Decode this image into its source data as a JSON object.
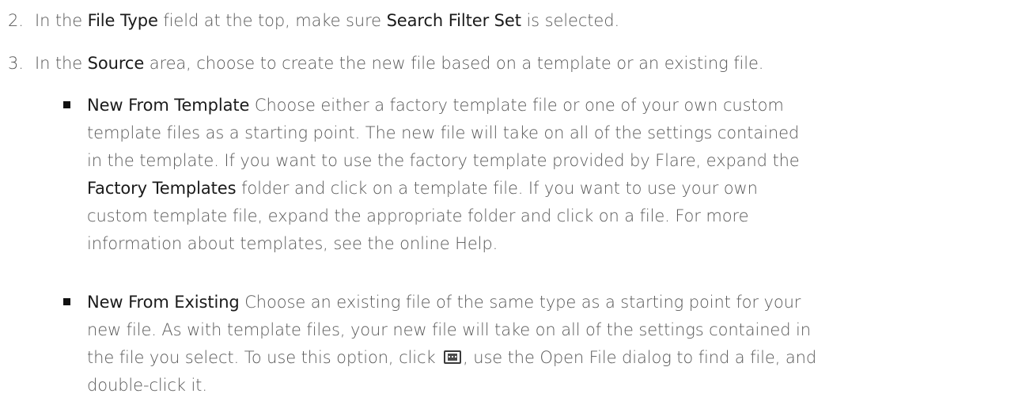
{
  "steps": [
    {
      "number": "2.",
      "parts": [
        "In the ",
        "File Type",
        " field at the top, make sure ",
        "Search Filter Set",
        " is selected."
      ]
    },
    {
      "number": "3.",
      "parts": [
        "In the ",
        "Source",
        " area, choose to create the new file based on a template or an existing file."
      ]
    }
  ],
  "bullets": [
    {
      "term": "New From Template",
      "lines": [
        " Choose either a factory template file or one of your own custom",
        "template files as a starting point. The new file will take on all of the settings contained",
        "in the template. If you want to use the factory template provided by Flare, expand the"
      ],
      "inline_term": "Factory Templates",
      "after_inline": " folder and click on a template file. If you want to use your own",
      "tail_lines": [
        "custom template file, expand the appropriate folder and click on a file. For more",
        "information about templates, see the online Help."
      ]
    },
    {
      "term": "New From Existing",
      "lines": [
        " Choose an existing file of the same type as a starting point for your",
        "new file. As with template files, your new file will take on all of the settings contained in"
      ],
      "before_icon": "the file you select. To use this option, click ",
      "icon": "browse-button-icon",
      "after_icon": ", use the Open File dialog to find a file, and",
      "tail_lines": [
        "double-click it."
      ]
    }
  ]
}
